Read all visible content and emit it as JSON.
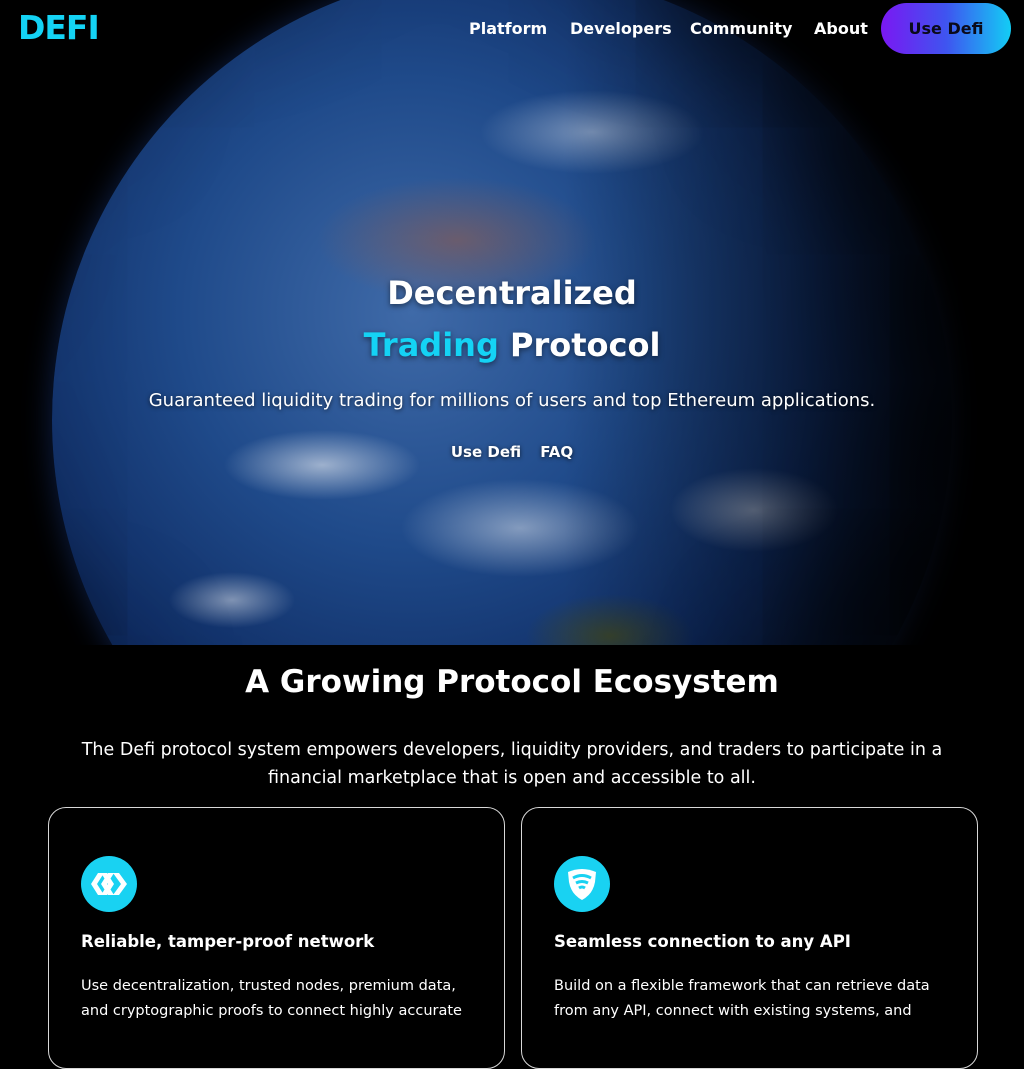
{
  "nav": {
    "logo": "DEFI",
    "links": [
      "Platform",
      "Developers",
      "Community",
      "About"
    ],
    "cta_label": "Use Defi"
  },
  "hero": {
    "title_line1": "Decentralized",
    "title_accent": "Trading",
    "title_rest": "Protocol",
    "subtitle": "Guaranteed liquidity trading for millions of users and top Ethereum applications.",
    "links": [
      "Use Defi",
      "FAQ"
    ]
  },
  "ecosystem": {
    "title": "A Growing Protocol Ecosystem",
    "description": "The Defi protocol system empowers developers, liquidity providers, and traders to participate in a financial marketplace that is open and accessible to all.",
    "cards": [
      {
        "icon": "hive-chevron-icon",
        "title": "Reliable, tamper-proof network",
        "text": "Use decentralization, trusted nodes, premium data, and cryptographic proofs to connect highly accurate"
      },
      {
        "icon": "wifi-shield-icon",
        "title": "Seamless connection to any API",
        "text": "Build on a flexible framework that can retrieve data from any API, connect with existing systems, and"
      }
    ]
  },
  "colors": {
    "accent": "#14d3f5",
    "cta_gradient_start": "#7a18f2",
    "cta_gradient_end": "#13cdf4",
    "background": "#000000"
  }
}
